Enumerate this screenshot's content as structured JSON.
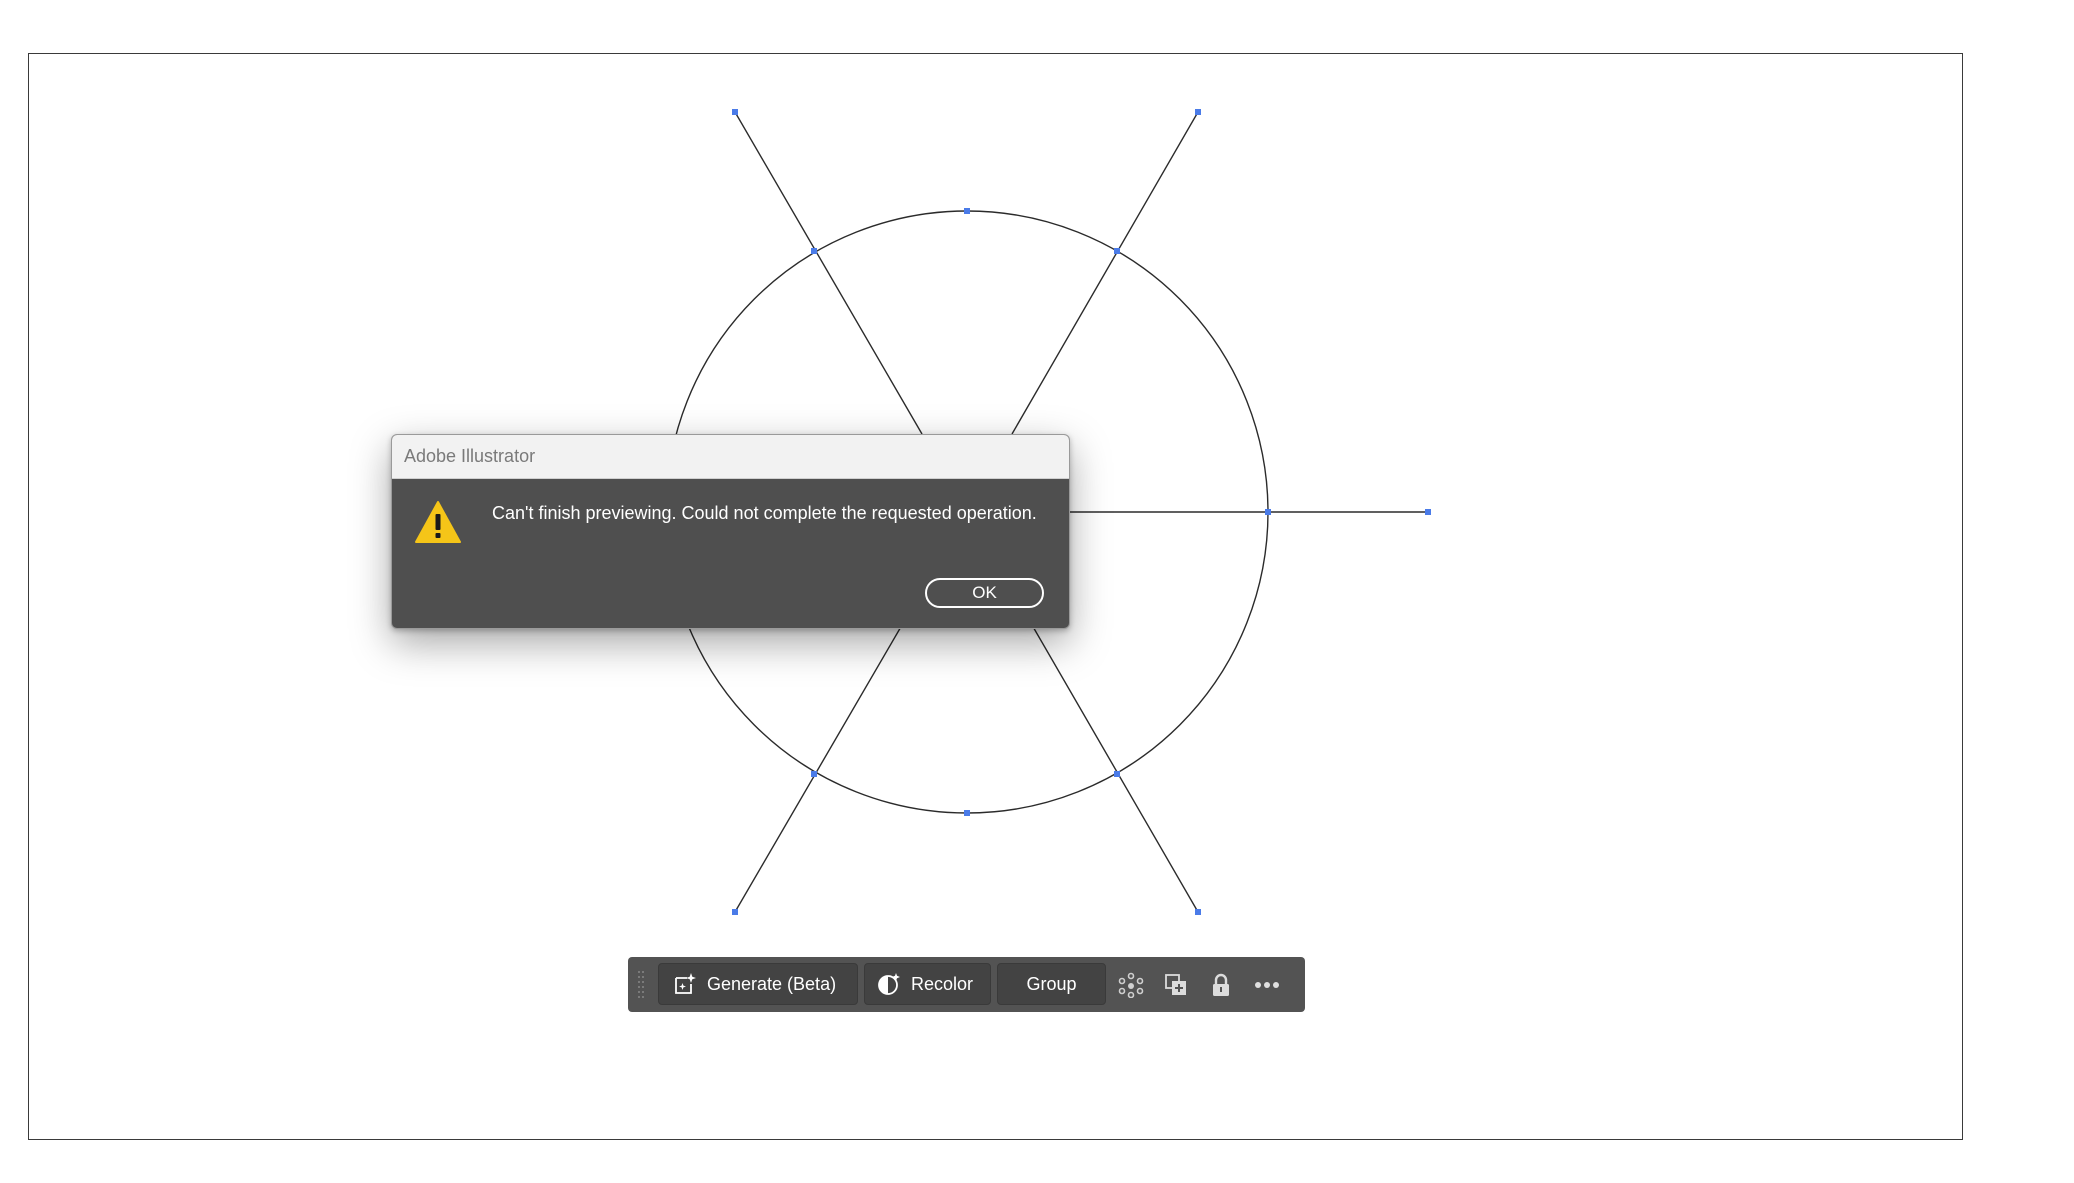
{
  "dialog": {
    "title": "Adobe Illustrator",
    "message": "Can't finish previewing. Could not complete the requested operation.",
    "ok_label": "OK",
    "icon": "warning-icon"
  },
  "taskbar": {
    "generate_label": "Generate (Beta)",
    "recolor_label": "Recolor",
    "group_label": "Group",
    "icons": [
      "generate-sparkle-icon",
      "recolor-icon",
      "isolate-icon",
      "arrange-icon",
      "lock-icon",
      "more-options-icon"
    ]
  },
  "colors": {
    "anchor": "#4a7be8",
    "dialog_bg": "#4f4f4f",
    "taskbar_bg": "#535353",
    "warning": "#f5c518"
  }
}
